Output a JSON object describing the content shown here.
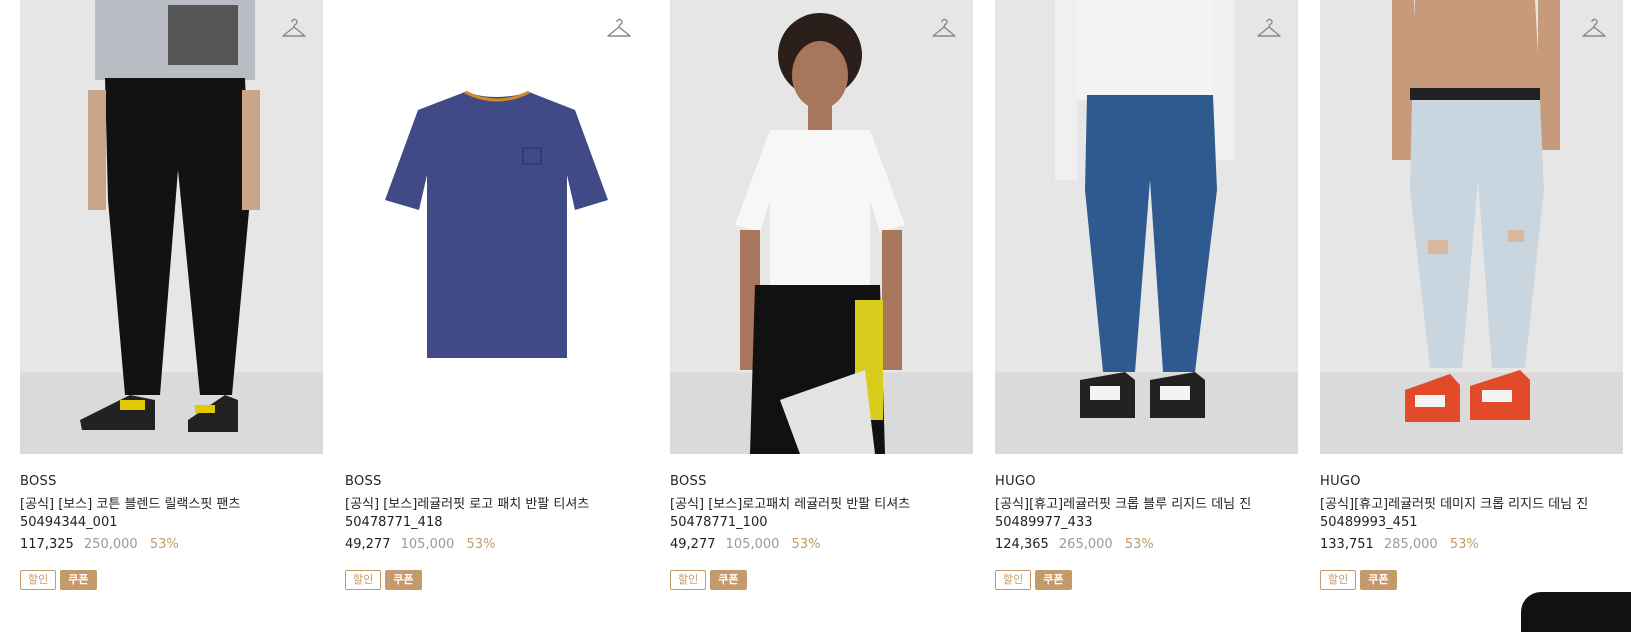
{
  "products": [
    {
      "brand": "BOSS",
      "name": "[공식] [보스] 코튼 블렌드 릴랙스핏 팬츠",
      "code": "50494344_001",
      "sale_price": "117,325",
      "original_price": "250,000",
      "discount": "53%",
      "badges": [
        "할인",
        "쿠폰"
      ]
    },
    {
      "brand": "BOSS",
      "name": "[공식] [보스]레귤러핏 로고 패치 반팔 티셔츠",
      "code": "50478771_418",
      "sale_price": "49,277",
      "original_price": "105,000",
      "discount": "53%",
      "badges": [
        "할인",
        "쿠폰"
      ]
    },
    {
      "brand": "BOSS",
      "name": "[공식] [보스]로고패치 레귤러핏 반팔 티셔츠",
      "code": "50478771_100",
      "sale_price": "49,277",
      "original_price": "105,000",
      "discount": "53%",
      "badges": [
        "할인",
        "쿠폰"
      ]
    },
    {
      "brand": "HUGO",
      "name": "[공식][휴고]레귤러핏 크롭 블루 리지드 데님 진",
      "code": "50489977_433",
      "sale_price": "124,365",
      "original_price": "265,000",
      "discount": "53%",
      "badges": [
        "할인",
        "쿠폰"
      ]
    },
    {
      "brand": "HUGO",
      "name": "[공식][휴고]레귤러핏 데미지 크롭 리지드 데님 진",
      "code": "50489993_451",
      "sale_price": "133,751",
      "original_price": "285,000",
      "discount": "53%",
      "badges": [
        "할인",
        "쿠폰"
      ]
    }
  ],
  "colors": {
    "accent": "#c49a6c",
    "original_price": "#9a9a9a"
  }
}
